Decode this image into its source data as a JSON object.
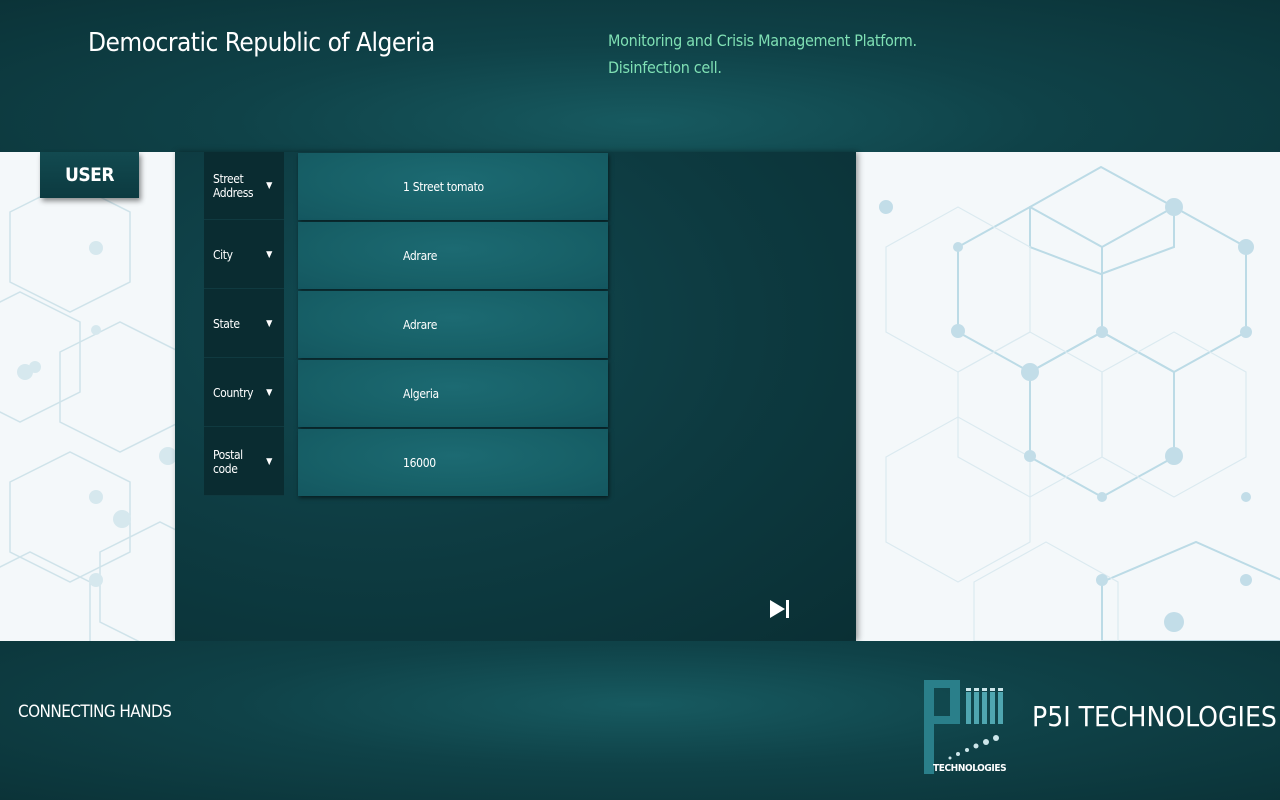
{
  "header": {
    "title": "Democratic Republic of Algeria",
    "subtitle_line1": "Monitoring and Crisis Management Platform.",
    "subtitle_line2": "Disinfection cell."
  },
  "sidebar": {
    "user_tab": "USER"
  },
  "form": {
    "fields": [
      {
        "label": "Street\nAddress",
        "value": "1 Street tomato"
      },
      {
        "label": "City",
        "value": "Adrare"
      },
      {
        "label": "State",
        "value": "Adrare"
      },
      {
        "label": "Country",
        "value": "Algeria"
      },
      {
        "label": "Postal\ncode",
        "value": "16000"
      }
    ]
  },
  "footer": {
    "slogan": "CONNECTING HANDS",
    "logo_text": "TECHNOLOGIES",
    "brand": "P5I TECHNOLOGIES"
  },
  "colors": {
    "teal_dark": "#0b3338",
    "teal_field": "#176067",
    "subtitle_green": "#7fe0b4"
  },
  "icons": {
    "dropdown": "caret-down-icon",
    "next": "skip-next-icon"
  }
}
